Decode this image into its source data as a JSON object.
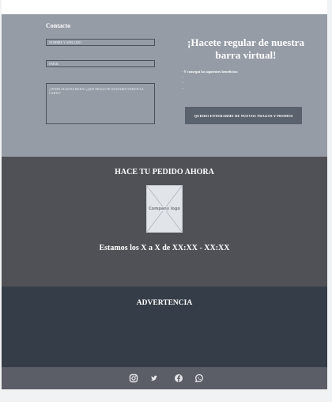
{
  "contact": {
    "title": "Contacto",
    "name_placeholder": "NOMBRE Y APELLIDO",
    "email_placeholder": "EMAIL",
    "message_placeholder": "¿TENES ALGUNA DUDA? ¿QUE TRAGO TE GUSTARIA VER EN LA CARTA?"
  },
  "promo": {
    "title_line1": "¡Hacete regular de nuestra",
    "title_line2": "barra virtual!",
    "benefits_intro": "- Y conseguí los siguientes beneficios:",
    "bullets": [
      "",
      "",
      ""
    ],
    "button_label": "QUIERO ENTERARME DE NUEVOS TRAGOS Y PROMOS"
  },
  "order": {
    "title": "HACE TU PEDIDO AHORA",
    "logo_text": "Company logo",
    "hours": "Estamos los X a X de XX:XX - XX:XX"
  },
  "warning": {
    "title": "ADVERTENCIA"
  },
  "footer": {
    "social": [
      "instagram-icon",
      "twitter-icon",
      "facebook-icon",
      "whatsapp-icon"
    ]
  },
  "colors": {
    "contact_bg": "#959ca6",
    "order_bg": "#4f5157",
    "warning_bg": "#353e48",
    "footer_bg": "#5b5e66",
    "button_bg": "#5a626d"
  }
}
